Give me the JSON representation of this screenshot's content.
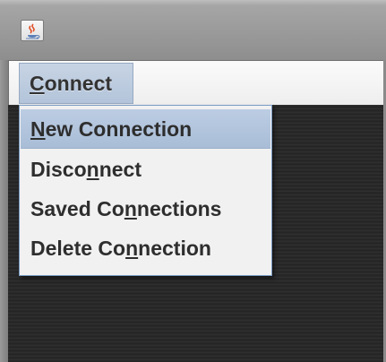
{
  "window": {
    "icon": "java-coffee-cup-icon"
  },
  "menubar": {
    "menus": [
      {
        "label_pre": "",
        "label_mn": "C",
        "label_post": "onnect"
      }
    ]
  },
  "dropdown": {
    "items": [
      {
        "pre": "",
        "mn": "N",
        "post": "ew Connection",
        "selected": true
      },
      {
        "pre": "Disco",
        "mn": "n",
        "post": "nect",
        "selected": false
      },
      {
        "pre": "Saved Co",
        "mn": "n",
        "post": "nections",
        "selected": false
      },
      {
        "pre": "Delete Co",
        "mn": "n",
        "post": "nection",
        "selected": false
      }
    ]
  },
  "colors": {
    "menu_highlight": "#b3c4da",
    "menu_border": "#7a9bc4",
    "background_content": "#2a2a2a"
  }
}
